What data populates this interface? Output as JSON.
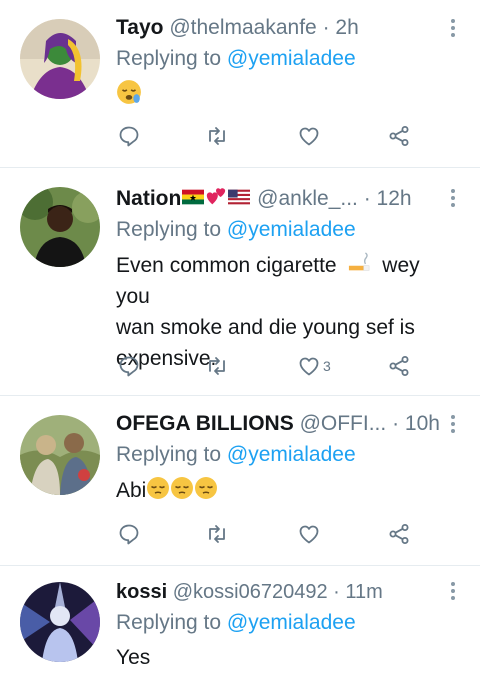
{
  "tweets": [
    {
      "name": "Tayo",
      "handle": "@thelmaakanfe",
      "time": "· 2h",
      "reply_prefix": "Replying to ",
      "reply_to": "@yemialadee",
      "text": "",
      "emojis": [
        "sleepy-face"
      ],
      "likes": "",
      "avatar": "avatar-tayo"
    },
    {
      "name": "Nation",
      "name_emojis": [
        "ghana-flag",
        "two-hearts",
        "us-flag"
      ],
      "handle": "@ankle_...",
      "time": "· 12h",
      "reply_prefix": "Replying to ",
      "reply_to": "@yemialadee",
      "text_line1": "Even common cigarette",
      "text_line1_after": " wey you",
      "text_rest": "wan smoke and die young sef is expensive.",
      "likes": "3",
      "avatar": "avatar-nation"
    },
    {
      "name": "OFEGA BILLIONS",
      "handle": "@OFFI...",
      "time": "· 10h",
      "reply_prefix": "Replying to ",
      "reply_to": "@yemialadee",
      "text": "Abi",
      "emojis": [
        "pensive-face",
        "pensive-face",
        "pensive-face"
      ],
      "likes": "",
      "avatar": "avatar-ofega"
    },
    {
      "name": "kossi",
      "handle": "@kossi06720492",
      "time": "· 11m",
      "reply_prefix": "Replying to ",
      "reply_to": "@yemialadee",
      "text": "Yes",
      "avatar": "avatar-kossi"
    }
  ],
  "icons": {
    "reply": "reply-icon",
    "retweet": "retweet-icon",
    "like": "like-icon",
    "share": "share-icon",
    "more": "more-options-icon"
  },
  "colors": {
    "name": "#14171a",
    "secondary": "#657786",
    "mention": "#1da1f2",
    "icon": "#657786",
    "divider": "#e6ecf0"
  }
}
